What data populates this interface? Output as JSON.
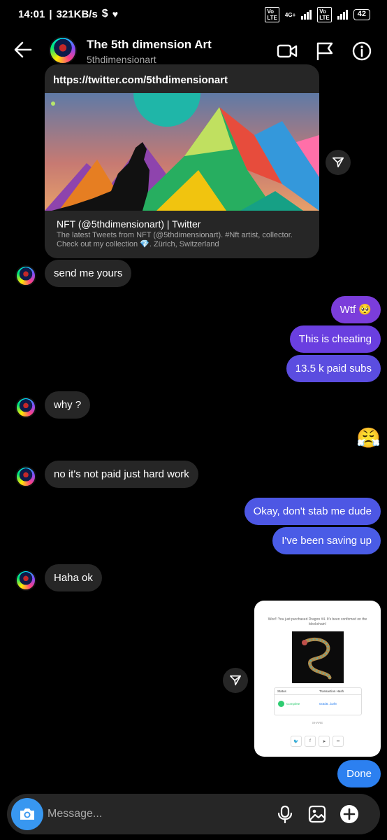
{
  "status_bar": {
    "time": "14:01",
    "speed": "321KB/s",
    "battery": "42",
    "network_label": "4G+"
  },
  "header": {
    "name": "The 5th dimension Art",
    "handle": "5thdimensionart",
    "icons": [
      "back-arrow-icon",
      "video-camera-icon",
      "flag-icon",
      "info-icon"
    ]
  },
  "link_preview": {
    "url": "https://twitter.com/5thdimensionart",
    "title": "NFT (@5thdimensionart) | Twitter",
    "description": "The latest Tweets from NFT (@5thdimensionart). #Nft artist, collector. Check out my collection 💎. Zürich, Switzerland"
  },
  "messages": [
    {
      "from": "them",
      "text": "send me yours"
    },
    {
      "from": "me",
      "text": "Wtf 🥺"
    },
    {
      "from": "me",
      "text": "This is cheating"
    },
    {
      "from": "me",
      "text": "13.5 k paid subs"
    },
    {
      "from": "them",
      "text": "why ?"
    },
    {
      "from": "me",
      "text": "😤"
    },
    {
      "from": "them",
      "text": "no it's not paid just hard work"
    },
    {
      "from": "me",
      "text": "Okay, don't stab me dude"
    },
    {
      "from": "me",
      "text": "I've been saving up"
    },
    {
      "from": "them",
      "text": "Haha ok"
    },
    {
      "from": "me",
      "text": "Done"
    }
  ],
  "shared_screenshot": {
    "text": "Woo!! You just purchased Dragon #4. It's been confirmed on the blockchain!",
    "col_status": "Status",
    "col_tx": "Transaction Hash",
    "status_value": "Complete",
    "tx_value": "0x6d8...b2f8",
    "share_label": "SHARE"
  },
  "colors": {
    "sent_purple": "#7b3ddb",
    "sent_indigo": "#5b4de0",
    "sent_blue": "#4a5ce6",
    "sent_done": "#2c80f0",
    "received": "#262626",
    "camera": "#3897f0"
  },
  "composer": {
    "placeholder": "Message..."
  }
}
